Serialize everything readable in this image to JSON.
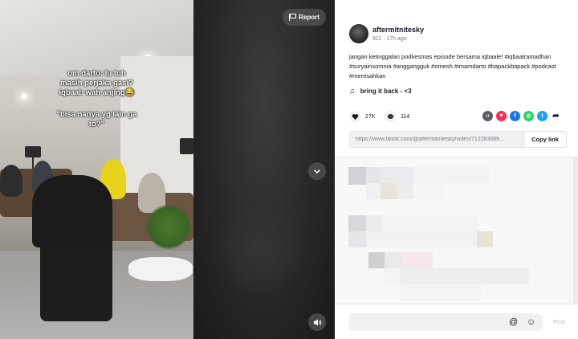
{
  "video": {
    "caption_line1": "om darto: lu tuh masih perjaka gasi?",
    "caption_line2": "iqbaal: wah anjing😂",
    "caption_line3": "\"bisa nanya yg lain ga to?\"",
    "report_label": "Report"
  },
  "post": {
    "username": "aftermitnitesky",
    "meta": "911 · 17h ago",
    "description": "jangan ketinggalan podkesmas episode bersama iqbaale! #iqbaalramadhan #suryainsomnia #anggangguk #omesh #imamdarto #bapackbapack #podcast #meresahkan",
    "music": "bring it back - <3",
    "likes": "27K",
    "comments": "114",
    "link": "https://www.tiktok.com/@aftermitnitesky/video/712283089...",
    "copy_label": "Copy link"
  },
  "comment_box": {
    "post_label": "Post"
  },
  "colors": {
    "accent": "#fe2c55",
    "facebook": "#1877f2",
    "whatsapp": "#25d366",
    "twitter": "#1da1f2"
  },
  "icons": [
    "flag-icon",
    "chevron-down-icon",
    "volume-icon",
    "heart-icon",
    "comment-icon",
    "embed-icon",
    "friends-icon",
    "facebook-icon",
    "whatsapp-icon",
    "twitter-icon",
    "share-arrow-icon",
    "music-note-icon",
    "at-icon",
    "emoji-icon"
  ]
}
